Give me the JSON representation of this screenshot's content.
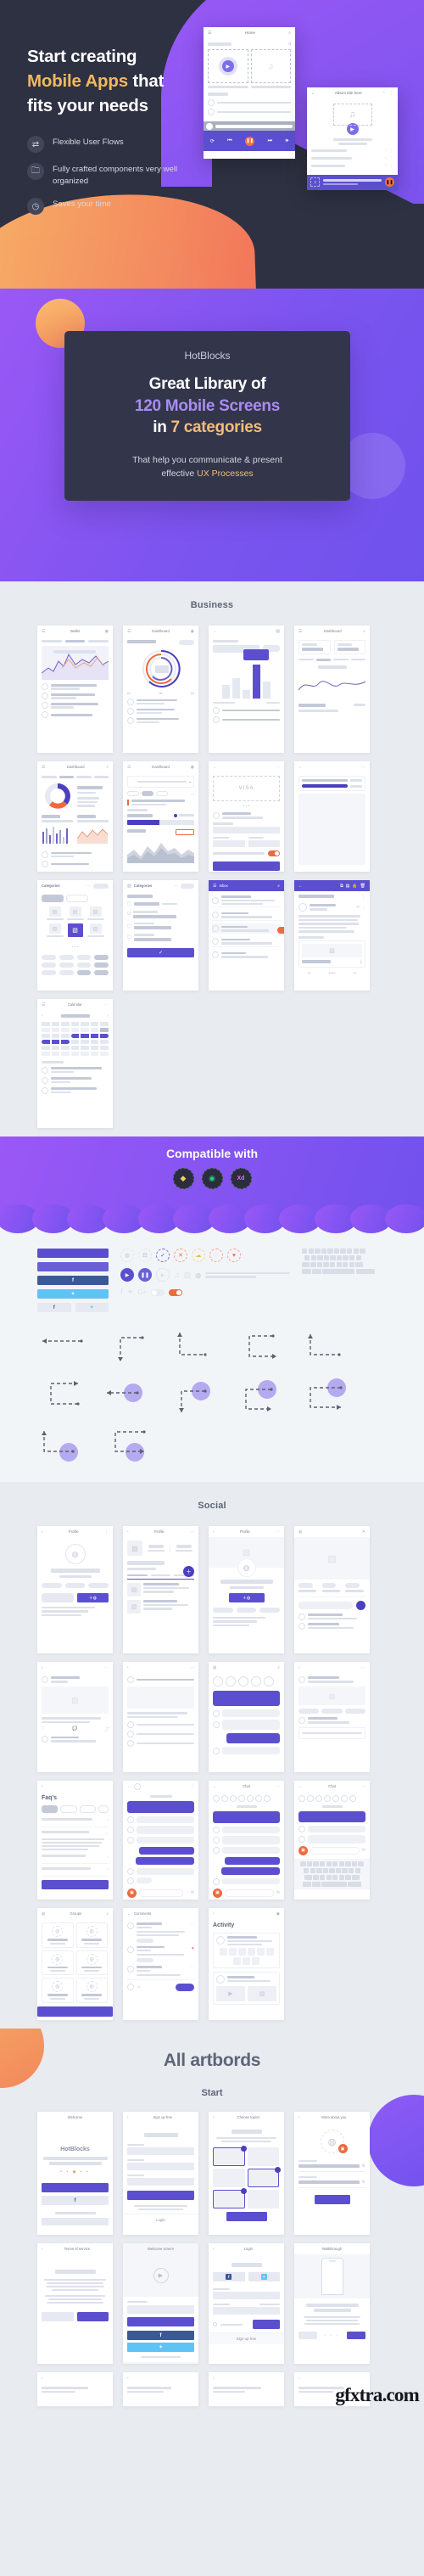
{
  "hero": {
    "headline_line1": "Start creating",
    "headline_accent": "Mobile Apps",
    "headline_line2_rest": " that",
    "headline_line3": "fits your needs",
    "features": [
      {
        "icon": "transfer-arrows-icon",
        "glyph": "⇄",
        "label": "Flexible User Flows"
      },
      {
        "icon": "folder-icon",
        "glyph": "🗀",
        "label": "Fully crafted components very well organized"
      },
      {
        "icon": "clock-icon",
        "glyph": "◷",
        "label": "Saves your time"
      }
    ],
    "mock1": {
      "title": "Home",
      "menu_icon": "hamburger-icon",
      "search_icon": "search-icon",
      "shuffle_icon": "shuffle-icon",
      "play_icon": "play-icon"
    },
    "mock2": {
      "title": "Album title here",
      "back_icon": "chevron-down-icon",
      "heart_icon": "heart-icon",
      "more_icon": "more-vertical-icon",
      "music_icon": "music-note-icon"
    }
  },
  "cta": {
    "brand": "HotBlocks",
    "line1": "Great Library of",
    "count": "120 Mobile Screens",
    "in_word": "in ",
    "categories": "7 categories",
    "sub_line1": "That help you communicate & present",
    "sub_line2_pre": "effective ",
    "sub_line2_accent": "UX Processes"
  },
  "sections": {
    "business": {
      "title": "Business",
      "cards": [
        {
          "title": "Wallet",
          "left_icon": "hamburger-icon",
          "right_icon": "user-icon",
          "kind": "chart-area"
        },
        {
          "title": "Dashboard",
          "left_icon": "hamburger-icon",
          "right_icon": "avatar-icon",
          "kind": "donut-rings"
        },
        {
          "title": "",
          "left_icon": "back-arrow-icon",
          "right_icon": "calendar-icon",
          "kind": "bar-chart"
        },
        {
          "title": "Dashboard",
          "left_icon": "hamburger-icon",
          "right_icon": "search-icon",
          "kind": "stat-cards"
        },
        {
          "title": "Dashboard",
          "left_icon": "hamburger-icon",
          "right_icon": "search-icon",
          "kind": "donut-legend"
        },
        {
          "title": "Dashboard",
          "left_icon": "hamburger-icon",
          "right_icon": "avatar-icon",
          "kind": "progress-list"
        },
        {
          "title": "",
          "left_icon": "back-arrow-icon",
          "right_icon": "more-icon",
          "kind": "card-visa"
        },
        {
          "title": "",
          "left_icon": "",
          "right_icon": "",
          "kind": "plain-list"
        },
        {
          "title": "Categories",
          "left_icon": "",
          "right_icon": "chip",
          "kind": "grid-tiles"
        },
        {
          "title": "Categories",
          "left_icon": "image-icon",
          "right_icon": "chip",
          "kind": "checklist"
        },
        {
          "title": "Inbox",
          "left_icon": "hamburger-icon",
          "right_icon": "search-icon",
          "kind": "inbox"
        },
        {
          "title": "",
          "left_icon": "back-arrow-icon",
          "right_icon": "share-icon",
          "kind": "mail-detail"
        },
        {
          "title": "Calendar",
          "left_icon": "hamburger-icon",
          "right_icon": "more-icon",
          "kind": "calendar"
        }
      ]
    },
    "compatible": {
      "title": "Compatible with",
      "logos": [
        {
          "name": "sketch-logo-icon",
          "glyph": "◆"
        },
        {
          "name": "figma-logo-icon",
          "glyph": "◉"
        },
        {
          "name": "adobe-xd-logo-icon",
          "glyph": "Xd"
        }
      ],
      "buttons": [
        {
          "name": "primary-button",
          "color": "#5b4fcf"
        },
        {
          "name": "secondary-button",
          "color": "#6b5fd8"
        },
        {
          "name": "facebook-button",
          "color": "#3b5998",
          "glyph": "f"
        },
        {
          "name": "twitter-button",
          "color": "#5fc3f5",
          "glyph": "t"
        },
        {
          "name": "facebook-small-button",
          "color": "#e6e9f1",
          "glyph": "f"
        },
        {
          "name": "twitter-small-button",
          "color": "#e6e9f1",
          "glyph": "t"
        }
      ],
      "icons": [
        "user-icon",
        "cart-icon",
        "check-icon",
        "close-icon",
        "cloud-icon",
        "heart-outline-icon",
        "heart-filled-icon",
        "play-filled-icon",
        "pause-filled-icon",
        "play-outline-icon",
        "music-icon",
        "image-icon",
        "person-icon",
        "slider-icon",
        "facebook-icon",
        "twitter-icon",
        "google-plus-icon",
        "toggle-off-icon",
        "toggle-on-icon",
        "back-arrow-icon",
        "search-icon",
        "circle-icon",
        "radio-checked-icon",
        "list-icon",
        "card-icon",
        "chevron-down-icon",
        "chevron-up-icon",
        "more-vertical-icon",
        "trash-icon",
        "fire-icon",
        "check-circle-icon",
        "check-circle-filled-icon",
        "square-icon",
        "checkbox-checked-icon",
        "comment-icon",
        "cart-small-icon",
        "close-small-icon"
      ]
    },
    "social": {
      "title": "Social",
      "cards": [
        {
          "title": "Profile",
          "left_icon": "back-arrow-icon",
          "right_icon": "more-vertical-icon",
          "kind": "profile-avatar"
        },
        {
          "title": "Profile",
          "left_icon": "back-arrow-icon",
          "right_icon": "more-icon",
          "kind": "profile-stats"
        },
        {
          "title": "Profile",
          "left_icon": "back-arrow-icon",
          "right_icon": "more-icon",
          "kind": "profile-cover"
        },
        {
          "title": "",
          "left_icon": "user-icon",
          "right_icon": "close-icon",
          "kind": "photo-post"
        },
        {
          "title": "",
          "left_icon": "back-arrow-icon",
          "right_icon": "",
          "kind": "feed"
        },
        {
          "title": "",
          "left_icon": "back-arrow-icon",
          "right_icon": "",
          "kind": "feed-2"
        },
        {
          "title": "",
          "left_icon": "",
          "right_icon": "",
          "kind": "story-list"
        },
        {
          "title": "",
          "left_icon": "",
          "right_icon": "",
          "kind": "notifications"
        },
        {
          "title": "Faq's",
          "left_icon": "back-arrow-icon",
          "right_icon": "",
          "kind": "faq"
        },
        {
          "title": "",
          "left_icon": "back-arrow-icon",
          "right_icon": "more-vertical-icon",
          "kind": "chat"
        },
        {
          "title": "Chat",
          "left_icon": "back-arrow-icon",
          "right_icon": "more-icon",
          "kind": "chat-2"
        },
        {
          "title": "Chat",
          "left_icon": "back-arrow-icon",
          "right_icon": "more-icon",
          "kind": "chat-keyboard"
        },
        {
          "title": "Groups",
          "left_icon": "user-icon",
          "right_icon": "search-icon",
          "kind": "groups"
        },
        {
          "title": "Comments",
          "left_icon": "back-arrow-icon",
          "right_icon": "",
          "kind": "comments"
        },
        {
          "title": "Activity",
          "left_icon": "back-arrow-icon",
          "right_icon": "avatar-icon",
          "kind": "activity"
        }
      ]
    },
    "all_artbords": {
      "title": "All artbords",
      "subtitle": "Start",
      "cards": [
        {
          "title": "Welcome",
          "brand": "HotBlocks",
          "kind": "welcome"
        },
        {
          "title": "Sign up free",
          "left_icon": "back-arrow-icon",
          "kind": "signup",
          "footer": "Login"
        },
        {
          "title": "Choose topics",
          "left_icon": "back-arrow-icon",
          "kind": "topics"
        },
        {
          "title": "More about you",
          "left_icon": "back-arrow-icon",
          "kind": "about-you"
        },
        {
          "title": "Terms of service",
          "left_icon": "back-arrow-icon",
          "kind": "terms"
        },
        {
          "title": "Welcome screen",
          "kind": "welcome-video"
        },
        {
          "title": "Login",
          "left_icon": "back-arrow-icon",
          "kind": "login",
          "footer": "Sign up free"
        },
        {
          "title": "Walkthrough",
          "kind": "walkthrough"
        }
      ]
    }
  },
  "watermark": "gfxtra.com"
}
